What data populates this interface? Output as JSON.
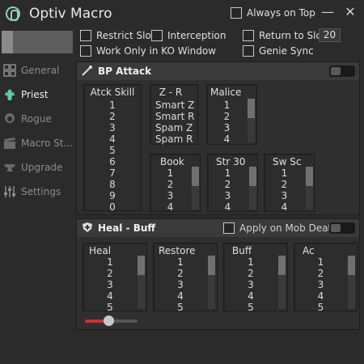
{
  "app": {
    "title": "Optiv Macro"
  },
  "titlebar": {
    "always_on_top": "Always on Top",
    "minimize": "—",
    "close": "✕"
  },
  "options": {
    "restrict_slot": "Restrict Slot",
    "interception": "Interception",
    "return_to_slot": "Return to Slot",
    "return_slot_value": "20",
    "ko_window": "Work Only in KO Window",
    "genie_sync": "Genie Sync"
  },
  "sidebar": {
    "items": [
      {
        "label": "General",
        "icon": "grid-icon"
      },
      {
        "label": "Priest",
        "icon": "priest-icon"
      },
      {
        "label": "Rogue",
        "icon": "rogue-icon"
      },
      {
        "label": "Macro St...",
        "icon": "clapper-icon"
      },
      {
        "label": "Upgrade",
        "icon": "anvil-icon"
      },
      {
        "label": "Settings",
        "icon": "sliders-icon"
      }
    ]
  },
  "bp_attack": {
    "title": "BP Attack",
    "atck_skill": {
      "title": "Atck Skill",
      "items": [
        "1",
        "2",
        "3",
        "4",
        "5",
        "6",
        "7",
        "8",
        "9",
        "0"
      ]
    },
    "z_r": {
      "title": "Z - R",
      "items": [
        "Smart Z",
        "Smart R",
        "Spam Z",
        "Spam R"
      ]
    },
    "malice": {
      "title": "Malice",
      "items": [
        "1",
        "2",
        "3",
        "4"
      ]
    },
    "book": {
      "title": "Book",
      "items": [
        "1",
        "2",
        "3",
        "4"
      ]
    },
    "str30": {
      "title": "Str 30",
      "items": [
        "1",
        "2",
        "3",
        "4"
      ]
    },
    "sw_sc": {
      "title": "Sw Sc",
      "items": [
        "1",
        "2",
        "3",
        "4"
      ]
    }
  },
  "heal_buff": {
    "title": "Heal - Buff",
    "apply_on_mob_death": "Apply on Mob Death",
    "heal": {
      "title": "Heal",
      "items": [
        "1",
        "2",
        "3",
        "4",
        "5"
      ]
    },
    "restore": {
      "title": "Restore",
      "items": [
        "1",
        "2",
        "3",
        "4",
        "5"
      ]
    },
    "buff": {
      "title": "Buff",
      "items": [
        "1",
        "2",
        "3",
        "4",
        "5"
      ]
    },
    "ac": {
      "title": "Ac",
      "items": [
        "1",
        "2",
        "3",
        "4",
        "5"
      ]
    },
    "slider_level": 0.45
  },
  "colors": {
    "accent": "#d03030",
    "logo": "#8fd0c0"
  }
}
